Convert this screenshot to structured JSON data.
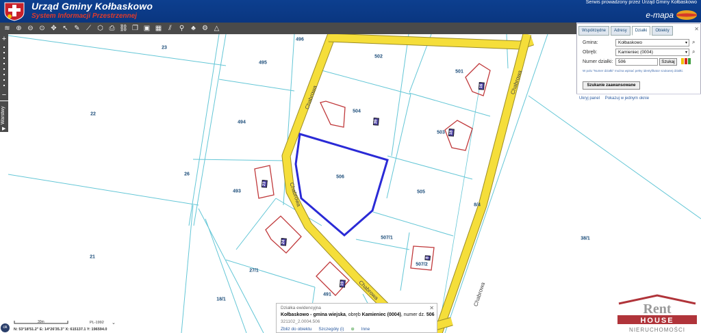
{
  "header": {
    "title": "Urząd Gminy Kołbaskowo",
    "subtitle": "System Informacji Przestrzennej",
    "provider": "Serwis prowadzony przez Urząd Gminy Kołbaskowo",
    "brand": "e-mapa"
  },
  "toolbar": {
    "tools": [
      "layers-icon",
      "zoom-in-icon",
      "zoom-out-icon",
      "zoom-extent-icon",
      "pan-icon",
      "pointer-icon",
      "pencil-icon",
      "measure-line-icon",
      "measure-area-icon",
      "print-icon",
      "link-icon",
      "copy-icon",
      "bus-icon",
      "table-icon",
      "hatch-icon",
      "streetview-icon",
      "tree-icon",
      "settings-icon",
      "triangle-icon"
    ]
  },
  "sidebar": {
    "layers_label": "Warstwy"
  },
  "panel": {
    "tabs": [
      "Współrzędne",
      "Adresy",
      "Działki",
      "Obiekty"
    ],
    "active_tab": "Działki",
    "gmina_label": "Gmina:",
    "gmina_value": "Kołbaskowo",
    "obreb_label": "Obręb:",
    "obreb_value": "Kamieniec (0004)",
    "numer_label": "Numer działki:",
    "numer_value": "506",
    "search_label": "Szukaj",
    "hint": "W polu \"Numer działki\" można wpisać pełny identyfikator szukanej działki.",
    "advanced_label": "Szukanie zaawansowane",
    "footer_hide": "Ukryj panel",
    "footer_show": "Pokazuj w jednym oknie",
    "swatches": [
      "#f2c200",
      "#d62a1f",
      "#3a9a3a"
    ]
  },
  "map": {
    "parcels": [
      {
        "label": "23"
      },
      {
        "label": "496"
      },
      {
        "label": "502"
      },
      {
        "label": "495"
      },
      {
        "label": "501"
      },
      {
        "label": "22"
      },
      {
        "label": "504"
      },
      {
        "label": "494"
      },
      {
        "label": "503"
      },
      {
        "label": "506"
      },
      {
        "label": "26"
      },
      {
        "label": "493"
      },
      {
        "label": "505"
      },
      {
        "label": "507/1"
      },
      {
        "label": "38/1"
      },
      {
        "label": "21"
      },
      {
        "label": "27/1"
      },
      {
        "label": "507/2"
      },
      {
        "label": "491"
      },
      {
        "label": "18/1"
      },
      {
        "label": "8/4"
      }
    ],
    "house_numbers": [
      "39",
      "16",
      "18",
      "23",
      "24",
      "8",
      "19"
    ],
    "streets": [
      "Chabrowa",
      "Chabrowa",
      "Chabrowa",
      "Chabrowa",
      "Chabrowa"
    ],
    "colors": {
      "road": "#f5de3a",
      "parcel_line": "#63c6d6",
      "selected": "#2a2ad6",
      "building": "#c0393b"
    }
  },
  "popup": {
    "title": "Działka ewidencyjna",
    "line_part1": "Kołbaskowo - gmina wiejska",
    "line_part2": ", obręb ",
    "line_part3": "Kamieniec (0004)",
    "line_part4": ", numer dz. ",
    "line_part5": "506",
    "id": "321102_2.0004.506",
    "link_zoom": "Zbliż do obiektu",
    "link_details": "Szczegóły (i)",
    "link_other": "Inne"
  },
  "status": {
    "ok_label": "ok",
    "scale_label": "30m",
    "crs": "PL-1992",
    "coords": "N: 53°18'51.2\"  E: 14°26'35.3\"  X: 615137.1  Y: 196594.0"
  },
  "watermark": {
    "line1": "Rent",
    "line2": "HOUSE",
    "line3": "NIERUCHOMOŚCI"
  }
}
